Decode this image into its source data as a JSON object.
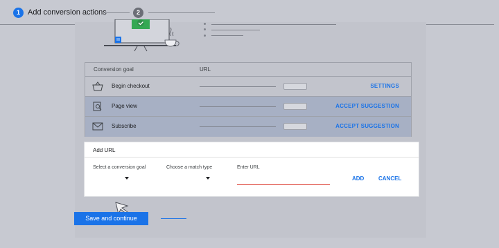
{
  "stepper": {
    "step1_number": "1",
    "step1_label": "Add conversion actions",
    "step2_number": "2"
  },
  "table": {
    "col_goal": "Conversion goal",
    "col_url": "URL",
    "rows": [
      {
        "label": "Begin checkout",
        "action": "SETTINGS",
        "icon": "basket-icon"
      },
      {
        "label": "Page view",
        "action": "ACCEPT SUGGESTION",
        "icon": "page-search-icon"
      },
      {
        "label": "Subscribe",
        "action": "ACCEPT SUGGESTION",
        "icon": "envelope-icon"
      }
    ]
  },
  "add_url": {
    "title": "Add URL",
    "goal_label": "Select a conversion goal",
    "match_label": "Choose a match type",
    "url_label": "Enter URL",
    "add_button": "ADD",
    "cancel_button": "CANCEL"
  },
  "footer": {
    "save_button": "Save and continue"
  },
  "colors": {
    "accent": "#1a73e8",
    "error": "#d93025",
    "success": "#34a853"
  }
}
